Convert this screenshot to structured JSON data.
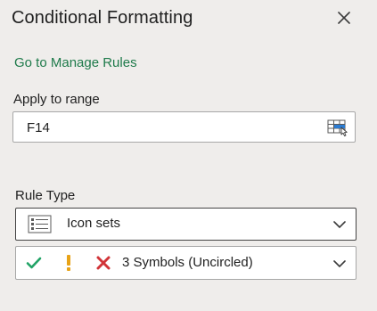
{
  "header": {
    "title": "Conditional Formatting",
    "close_icon": "close-icon"
  },
  "links": {
    "manage_rules": "Go to Manage Rules"
  },
  "apply_range": {
    "label": "Apply to range",
    "value": "F14",
    "picker_icon": "range-selector-icon"
  },
  "rule_type": {
    "label": "Rule Type",
    "selected": "Icon sets",
    "icon": "list-icon",
    "chevron": "chevron-down-icon"
  },
  "icon_style": {
    "selected": "3 Symbols (Uncircled)",
    "icons": [
      "checkmark-icon",
      "exclamation-icon",
      "cross-icon"
    ],
    "chevron": "chevron-down-icon"
  },
  "colors": {
    "background": "#efedeb",
    "link": "#1e7a4a",
    "check": "#21a366",
    "exclamation": "#e8a317",
    "cross": "#d13438"
  }
}
